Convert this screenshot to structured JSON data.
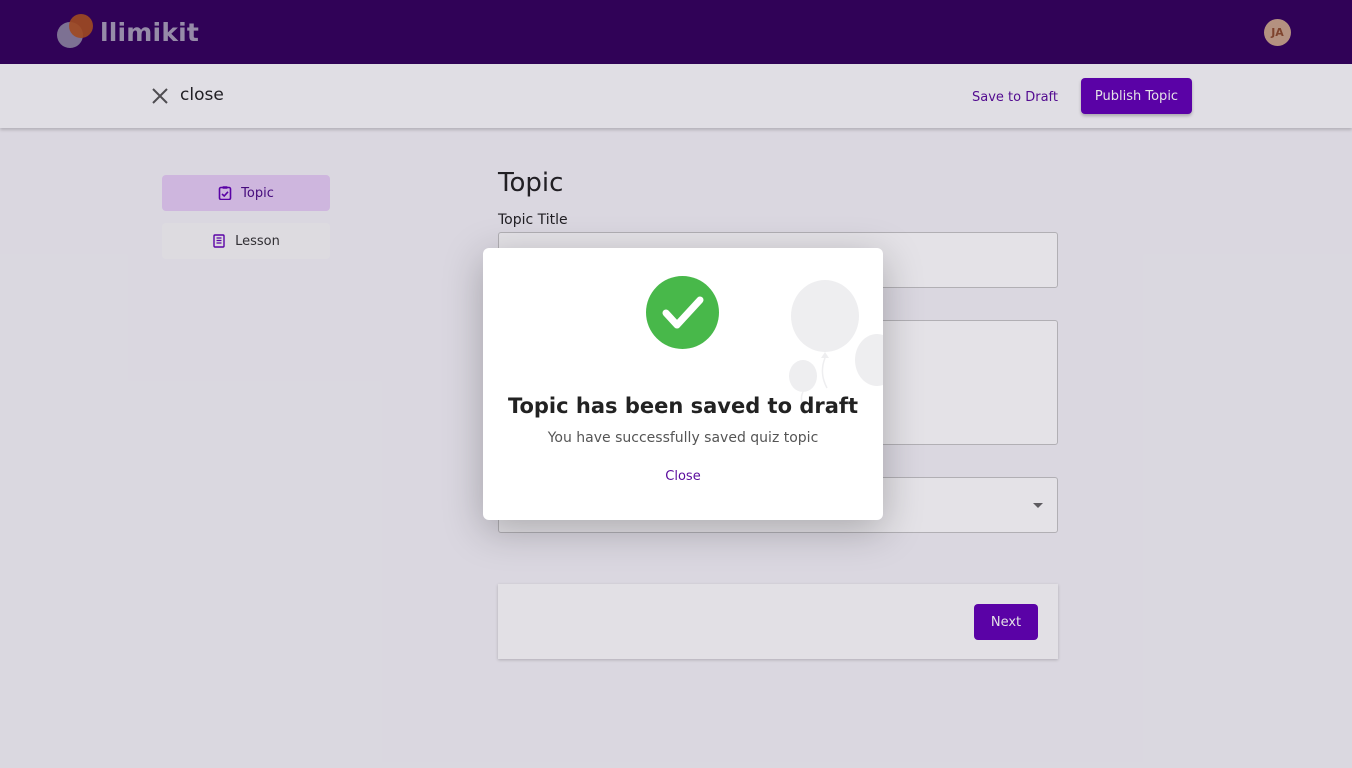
{
  "app": {
    "name": "llimikit",
    "user_initials": "JA"
  },
  "header": {
    "close_label": "close",
    "save_draft_label": "Save to Draft",
    "publish_label": "Publish Topic"
  },
  "sidebar": {
    "items": [
      {
        "label": "Topic",
        "active": true
      },
      {
        "label": "Lesson",
        "active": false
      }
    ]
  },
  "form": {
    "page_title": "Topic",
    "title_label": "Topic Title",
    "next_label": "Next"
  },
  "modal": {
    "title": "Topic has been saved to draft",
    "subtitle": "You have successfully saved quiz topic",
    "close_label": "Close"
  },
  "colors": {
    "brand": "#33005c",
    "accent": "#6200b5",
    "success": "#48b84a"
  }
}
